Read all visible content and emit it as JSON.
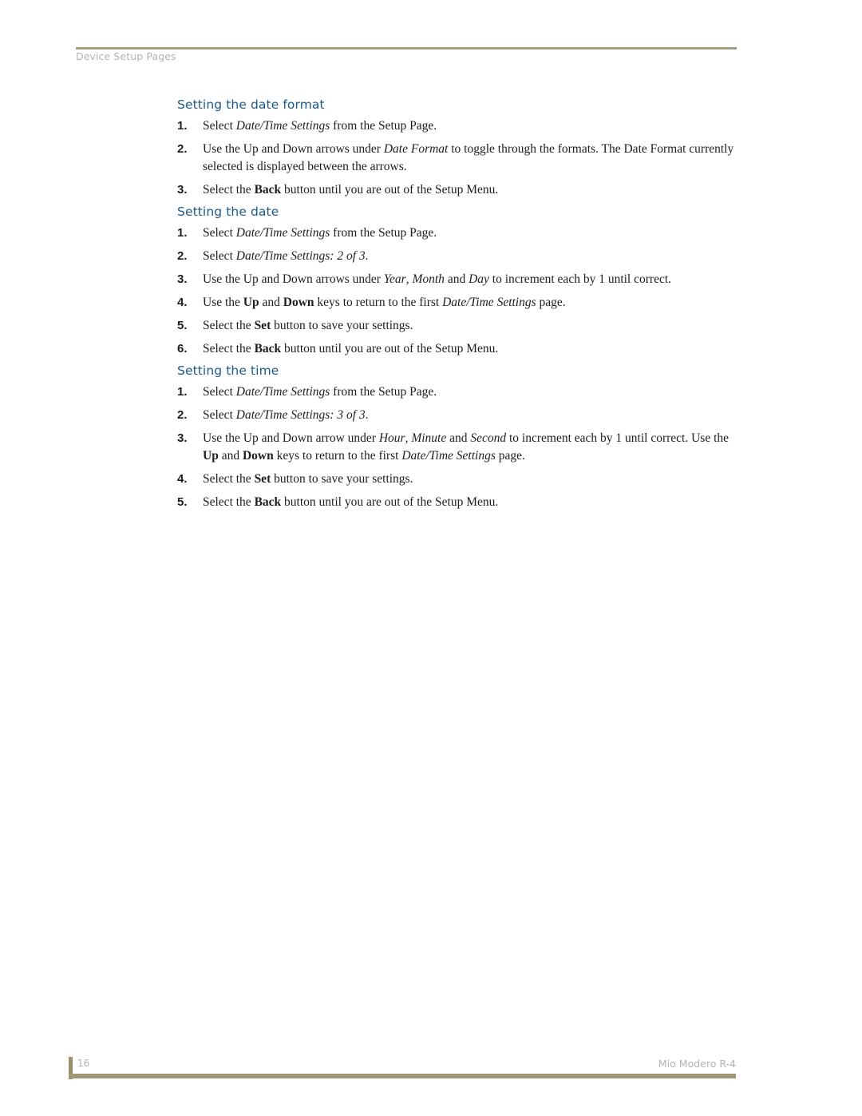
{
  "header": {
    "running_head": "Device Setup Pages",
    "rule_color": "#a3a07e"
  },
  "sections": [
    {
      "title": "Setting the date format",
      "steps": [
        {
          "num": "1.",
          "parts": [
            {
              "t": "Select "
            },
            {
              "t": "Date/Time Settings",
              "s": "i"
            },
            {
              "t": " from the Setup Page."
            }
          ]
        },
        {
          "num": "2.",
          "parts": [
            {
              "t": "Use the Up and Down arrows under "
            },
            {
              "t": "Date Format",
              "s": "i"
            },
            {
              "t": " to toggle through the formats. The Date Format currently selected is displayed between the arrows."
            }
          ]
        },
        {
          "num": "3.",
          "parts": [
            {
              "t": "Select the "
            },
            {
              "t": "Back",
              "s": "b"
            },
            {
              "t": " button until you are out of the Setup Menu."
            }
          ]
        }
      ]
    },
    {
      "title": "Setting the date",
      "steps": [
        {
          "num": "1.",
          "parts": [
            {
              "t": "Select "
            },
            {
              "t": "Date/Time Settings",
              "s": "i"
            },
            {
              "t": " from the Setup Page."
            }
          ]
        },
        {
          "num": "2.",
          "parts": [
            {
              "t": "Select "
            },
            {
              "t": "Date/Time Settings: 2 of 3",
              "s": "i"
            },
            {
              "t": "."
            }
          ]
        },
        {
          "num": "3.",
          "parts": [
            {
              "t": "Use the Up and Down arrows under "
            },
            {
              "t": "Year",
              "s": "i"
            },
            {
              "t": ", "
            },
            {
              "t": "Month",
              "s": "i"
            },
            {
              "t": " and "
            },
            {
              "t": "Day",
              "s": "i"
            },
            {
              "t": " to increment each by 1 until correct."
            }
          ]
        },
        {
          "num": "4.",
          "parts": [
            {
              "t": "Use the "
            },
            {
              "t": "Up",
              "s": "b"
            },
            {
              "t": " and "
            },
            {
              "t": "Down",
              "s": "b"
            },
            {
              "t": " keys to return to the first "
            },
            {
              "t": "Date/Time Settings",
              "s": "i"
            },
            {
              "t": " page."
            }
          ]
        },
        {
          "num": "5.",
          "parts": [
            {
              "t": "Select the "
            },
            {
              "t": "Set",
              "s": "b"
            },
            {
              "t": " button to save your settings."
            }
          ]
        },
        {
          "num": "6.",
          "parts": [
            {
              "t": "Select the "
            },
            {
              "t": "Back",
              "s": "b"
            },
            {
              "t": " button until you are out of the Setup Menu."
            }
          ]
        }
      ]
    },
    {
      "title": "Setting the time",
      "steps": [
        {
          "num": "1.",
          "parts": [
            {
              "t": "Select "
            },
            {
              "t": "Date/Time Settings",
              "s": "i"
            },
            {
              "t": " from the Setup Page."
            }
          ]
        },
        {
          "num": "2.",
          "parts": [
            {
              "t": "Select "
            },
            {
              "t": "Date/Time Settings: 3 of 3",
              "s": "i"
            },
            {
              "t": "."
            }
          ]
        },
        {
          "num": "3.",
          "parts": [
            {
              "t": "Use the Up and Down arrow under "
            },
            {
              "t": "Hour",
              "s": "i"
            },
            {
              "t": ", "
            },
            {
              "t": "Minute",
              "s": "i"
            },
            {
              "t": " and "
            },
            {
              "t": "Second",
              "s": "i"
            },
            {
              "t": " to increment each by 1 until correct. Use the "
            },
            {
              "t": "Up",
              "s": "b"
            },
            {
              "t": " and "
            },
            {
              "t": "Down",
              "s": "b"
            },
            {
              "t": " keys to return to the first "
            },
            {
              "t": "Date/Time Settings",
              "s": "i"
            },
            {
              "t": " page."
            }
          ]
        },
        {
          "num": "4.",
          "parts": [
            {
              "t": "Select the "
            },
            {
              "t": "Set",
              "s": "b"
            },
            {
              "t": " button to save your settings."
            }
          ]
        },
        {
          "num": "5.",
          "parts": [
            {
              "t": "Select the "
            },
            {
              "t": "Back",
              "s": "b"
            },
            {
              "t": " button until you are out of the Setup Menu."
            }
          ]
        }
      ]
    }
  ],
  "footer": {
    "page_number": "16",
    "doc_title": "Mio Modero R-4",
    "bar_color": "#a09775"
  },
  "colors": {
    "heading": "#1a5a8c",
    "body_text": "#1e1e1e",
    "running_text": "#b3b3b3"
  }
}
